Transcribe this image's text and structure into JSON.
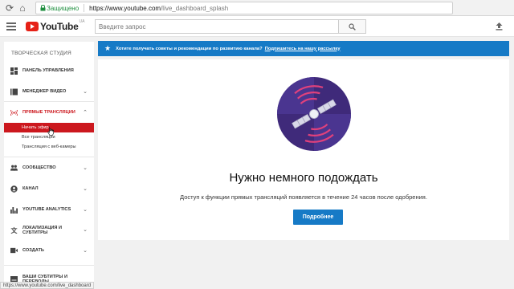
{
  "browser": {
    "secure_label": "Защищено",
    "url_host": "https://www.youtube.com",
    "url_path": "/live_dashboard_splash",
    "status_url": "https://www.youtube.com/live_dashboard"
  },
  "header": {
    "logo_text": "YouTube",
    "logo_region": "UA",
    "search_placeholder": "Введите запрос"
  },
  "sidebar": {
    "title": "ТВОРЧЕСКАЯ СТУДИЯ",
    "items": [
      {
        "label": "ПАНЕЛЬ УПРАВЛЕНИЯ",
        "icon": "dashboard-icon"
      },
      {
        "label": "МЕНЕДЖЕР ВИДЕО",
        "icon": "video-manager-icon"
      },
      {
        "label": "ПРЯМЫЕ ТРАНСЛЯЦИИ",
        "icon": "live-icon"
      },
      {
        "label": "СООБЩЕСТВО",
        "icon": "community-icon"
      },
      {
        "label": "КАНАЛ",
        "icon": "channel-icon"
      },
      {
        "label": "YOUTUBE ANALYTICS",
        "icon": "analytics-icon"
      },
      {
        "label_line1": "ЛОКАЛИЗАЦИЯ И",
        "label_line2": "СУБТИТРЫ",
        "icon": "translate-icon"
      },
      {
        "label": "СОЗДАТЬ",
        "icon": "create-icon"
      },
      {
        "label_line1": "ВАШИ СУБТИТРЫ И",
        "label_line2": "ПЕРЕВОДЫ",
        "icon": "subtitles-icon"
      }
    ],
    "live_sub": [
      "Начать эфир",
      "Все трансляции",
      "Трансляция с веб-камеры"
    ]
  },
  "banner": {
    "text": "Хотите получать советы и рекомендации по развитию канала?",
    "link": "Подпишитесь на нашу рассылку"
  },
  "main": {
    "heading": "Нужно немного подождать",
    "description": "Доступ к функции прямых трансляций появляется в течение 24 часов после одобрения.",
    "button": "Подробнее"
  },
  "colors": {
    "brand_red": "#e62117",
    "accent_blue": "#167ac6",
    "active_red": "#cc181e",
    "illustration_purple": "#3f2a7a"
  }
}
